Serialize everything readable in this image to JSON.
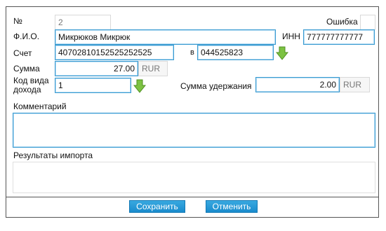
{
  "form": {
    "number_label": "№",
    "number_value": "2",
    "error_label": "Ошибка",
    "fio_label": "Ф.И.О.",
    "fio_value": "Микрюков Микрюк",
    "inn_label": "ИНН",
    "inn_value": "777777777777",
    "account_label": "Счет",
    "account_value": "40702810152525252525",
    "bank_prefix": "в",
    "bik_value": "044525823",
    "amount_label": "Сумма",
    "amount_value": "27.00",
    "amount_currency": "RUR",
    "income_code_label_line1": "Код вида",
    "income_code_label_line2": "дохода",
    "income_code_value": "1",
    "withholding_label": "Сумма удержания",
    "withholding_value": "2.00",
    "withholding_currency": "RUR",
    "comment_label": "Комментарий",
    "import_results_label": "Результаты импорта"
  },
  "footer": {
    "save_label": "Сохранить",
    "cancel_label": "Отменить"
  },
  "colors": {
    "accent": "#3a9bd1",
    "button": "#1a8ccd",
    "arrow": "#7cc242"
  },
  "icons": {
    "dropdown": "green-down-arrow-icon"
  }
}
